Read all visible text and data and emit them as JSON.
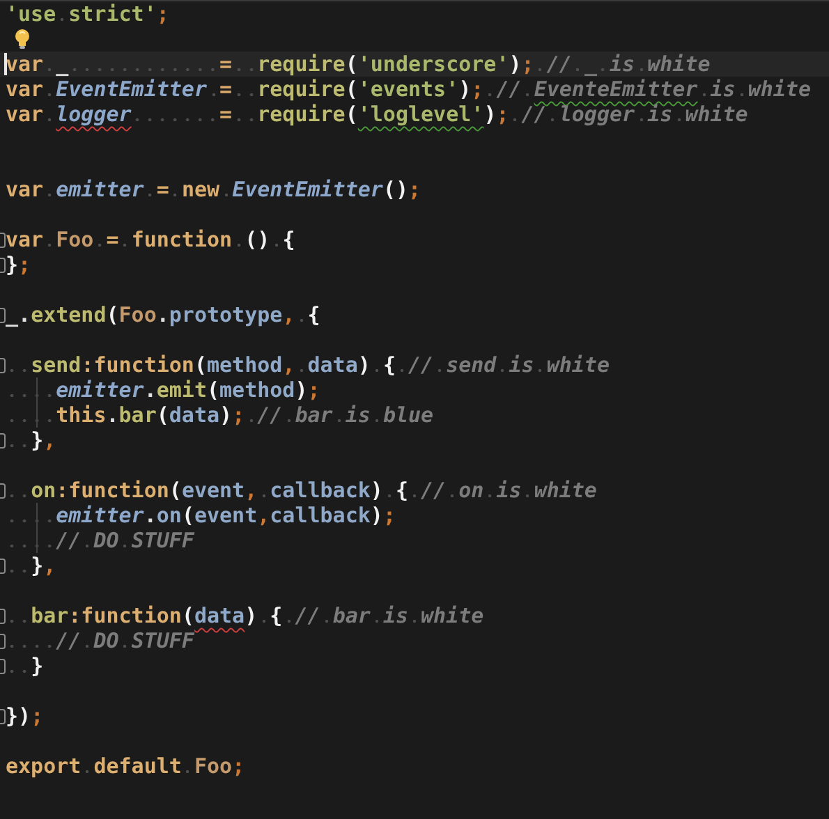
{
  "editor": {
    "lines": [
      {
        "kind": "code",
        "tokens": [
          {
            "kind": "str",
            "text": "'use strict'"
          },
          {
            "kind": "punct",
            "text": ";"
          }
        ]
      },
      {
        "kind": "hint"
      },
      {
        "kind": "code",
        "current": true,
        "tokens": [
          {
            "kind": "kw",
            "text": "var"
          },
          {
            "kind": "plain",
            "text": " _            "
          },
          {
            "kind": "op",
            "text": "="
          },
          {
            "kind": "call",
            "text": "  require"
          },
          {
            "kind": "brace",
            "text": "("
          },
          {
            "kind": "str",
            "text": "'underscore'"
          },
          {
            "kind": "brace",
            "text": ")"
          },
          {
            "kind": "punct",
            "text": ";"
          },
          {
            "kind": "comment",
            "text": " // _ is white"
          }
        ]
      },
      {
        "kind": "code",
        "tokens": [
          {
            "kind": "kw",
            "text": "var"
          },
          {
            "kind": "ivar",
            "text": " EventEmitter"
          },
          {
            "kind": "op",
            "text": " ="
          },
          {
            "kind": "call",
            "text": "  require"
          },
          {
            "kind": "brace",
            "text": "("
          },
          {
            "kind": "str",
            "text": "'events'"
          },
          {
            "kind": "brace",
            "text": ")"
          },
          {
            "kind": "punct",
            "text": ";"
          },
          {
            "kind": "comment",
            "text": " // "
          },
          {
            "kind": "comment",
            "text": "EventeEmitter",
            "misspelled": true
          },
          {
            "kind": "comment",
            "text": " is white"
          }
        ]
      },
      {
        "kind": "code",
        "tokens": [
          {
            "kind": "kw",
            "text": "var "
          },
          {
            "kind": "ivar",
            "text": "logger",
            "error": true
          },
          {
            "kind": "op",
            "text": "       ="
          },
          {
            "kind": "call",
            "text": "  require"
          },
          {
            "kind": "brace",
            "text": "("
          },
          {
            "kind": "str",
            "text": "'loglevel'",
            "misspelled": true
          },
          {
            "kind": "brace",
            "text": ")"
          },
          {
            "kind": "punct",
            "text": ";"
          },
          {
            "kind": "comment",
            "text": " // logger is white"
          }
        ]
      },
      {
        "kind": "blank"
      },
      {
        "kind": "blank"
      },
      {
        "kind": "code",
        "tokens": [
          {
            "kind": "kw",
            "text": "var"
          },
          {
            "kind": "ivar",
            "text": " emitter"
          },
          {
            "kind": "op",
            "text": " ="
          },
          {
            "kind": "kw",
            "text": " new"
          },
          {
            "kind": "ivar",
            "text": " EventEmitter"
          },
          {
            "kind": "brace",
            "text": "()"
          },
          {
            "kind": "punct",
            "text": ";"
          }
        ]
      },
      {
        "kind": "blank"
      },
      {
        "kind": "code",
        "fold": true,
        "tokens": [
          {
            "kind": "kw",
            "text": "var"
          },
          {
            "kind": "cls",
            "text": " Foo"
          },
          {
            "kind": "op",
            "text": " ="
          },
          {
            "kind": "kw",
            "text": " function"
          },
          {
            "kind": "brace",
            "text": " () {"
          }
        ]
      },
      {
        "kind": "code",
        "fold": true,
        "tokens": [
          {
            "kind": "brace",
            "text": "}"
          },
          {
            "kind": "punct",
            "text": ";"
          }
        ]
      },
      {
        "kind": "blank"
      },
      {
        "kind": "code",
        "fold": true,
        "tokens": [
          {
            "kind": "plain",
            "text": "_."
          },
          {
            "kind": "call",
            "text": "extend"
          },
          {
            "kind": "brace",
            "text": "("
          },
          {
            "kind": "cls",
            "text": "Foo"
          },
          {
            "kind": "plain",
            "text": "."
          },
          {
            "kind": "prop",
            "text": "prototype"
          },
          {
            "kind": "punct",
            "text": ","
          },
          {
            "kind": "brace",
            "text": " {"
          }
        ]
      },
      {
        "kind": "blank"
      },
      {
        "kind": "code",
        "fold": true,
        "tokens": [
          {
            "kind": "key",
            "text": "  send"
          },
          {
            "kind": "kw",
            "text": ":function"
          },
          {
            "kind": "brace",
            "text": "("
          },
          {
            "kind": "param",
            "text": "method"
          },
          {
            "kind": "punct",
            "text": ","
          },
          {
            "kind": "param",
            "text": " data"
          },
          {
            "kind": "brace",
            "text": ") {"
          },
          {
            "kind": "comment",
            "text": " // send is white"
          }
        ]
      },
      {
        "kind": "code",
        "guide": true,
        "tokens": [
          {
            "kind": "ivar",
            "text": "    emitter"
          },
          {
            "kind": "plain",
            "text": "."
          },
          {
            "kind": "call",
            "text": "emit"
          },
          {
            "kind": "brace",
            "text": "("
          },
          {
            "kind": "param",
            "text": "method"
          },
          {
            "kind": "brace",
            "text": ")"
          },
          {
            "kind": "punct",
            "text": ";"
          }
        ]
      },
      {
        "kind": "code",
        "guide": true,
        "tokens": [
          {
            "kind": "kw",
            "text": "    this"
          },
          {
            "kind": "plain",
            "text": "."
          },
          {
            "kind": "call",
            "text": "bar"
          },
          {
            "kind": "brace",
            "text": "("
          },
          {
            "kind": "param",
            "text": "data"
          },
          {
            "kind": "brace",
            "text": ")"
          },
          {
            "kind": "punct",
            "text": ";"
          },
          {
            "kind": "comment",
            "text": " // bar is blue"
          }
        ]
      },
      {
        "kind": "code",
        "fold": true,
        "tokens": [
          {
            "kind": "brace",
            "text": "  }"
          },
          {
            "kind": "punct",
            "text": ","
          }
        ]
      },
      {
        "kind": "blank"
      },
      {
        "kind": "code",
        "fold": true,
        "tokens": [
          {
            "kind": "key",
            "text": "  on"
          },
          {
            "kind": "kw",
            "text": ":function"
          },
          {
            "kind": "brace",
            "text": "("
          },
          {
            "kind": "param",
            "text": "event"
          },
          {
            "kind": "punct",
            "text": ","
          },
          {
            "kind": "param",
            "text": " callback"
          },
          {
            "kind": "brace",
            "text": ") {"
          },
          {
            "kind": "comment",
            "text": " // on is white"
          }
        ]
      },
      {
        "kind": "code",
        "guide": true,
        "tokens": [
          {
            "kind": "ivar",
            "text": "    emitter"
          },
          {
            "kind": "plain",
            "text": "."
          },
          {
            "kind": "prop",
            "text": "on"
          },
          {
            "kind": "brace",
            "text": "("
          },
          {
            "kind": "param",
            "text": "event"
          },
          {
            "kind": "punct",
            "text": ","
          },
          {
            "kind": "param",
            "text": "callback"
          },
          {
            "kind": "brace",
            "text": ")"
          },
          {
            "kind": "punct",
            "text": ";"
          }
        ]
      },
      {
        "kind": "code",
        "guide": true,
        "tokens": [
          {
            "kind": "comment",
            "text": "    // DO STUFF"
          }
        ]
      },
      {
        "kind": "code",
        "fold": true,
        "tokens": [
          {
            "kind": "brace",
            "text": "  }"
          },
          {
            "kind": "punct",
            "text": ","
          }
        ]
      },
      {
        "kind": "blank"
      },
      {
        "kind": "code",
        "fold": true,
        "tokens": [
          {
            "kind": "key",
            "text": "  bar"
          },
          {
            "kind": "kw",
            "text": ":function"
          },
          {
            "kind": "brace",
            "text": "("
          },
          {
            "kind": "param",
            "text": "data",
            "error": true
          },
          {
            "kind": "brace",
            "text": ") {"
          },
          {
            "kind": "comment",
            "text": " // bar is white"
          }
        ]
      },
      {
        "kind": "code",
        "fold": true,
        "tokens": [
          {
            "kind": "comment",
            "text": "    // DO STUFF"
          }
        ]
      },
      {
        "kind": "code",
        "fold": true,
        "tokens": [
          {
            "kind": "brace",
            "text": "  }"
          }
        ]
      },
      {
        "kind": "blank"
      },
      {
        "kind": "code",
        "fold": true,
        "tokens": [
          {
            "kind": "brace",
            "text": "})"
          },
          {
            "kind": "punct",
            "text": ";"
          }
        ]
      },
      {
        "kind": "blank"
      },
      {
        "kind": "code",
        "tokens": [
          {
            "kind": "kw",
            "text": "export default"
          },
          {
            "kind": "cls",
            "text": " Foo"
          },
          {
            "kind": "punct",
            "text": ";"
          }
        ]
      }
    ]
  }
}
